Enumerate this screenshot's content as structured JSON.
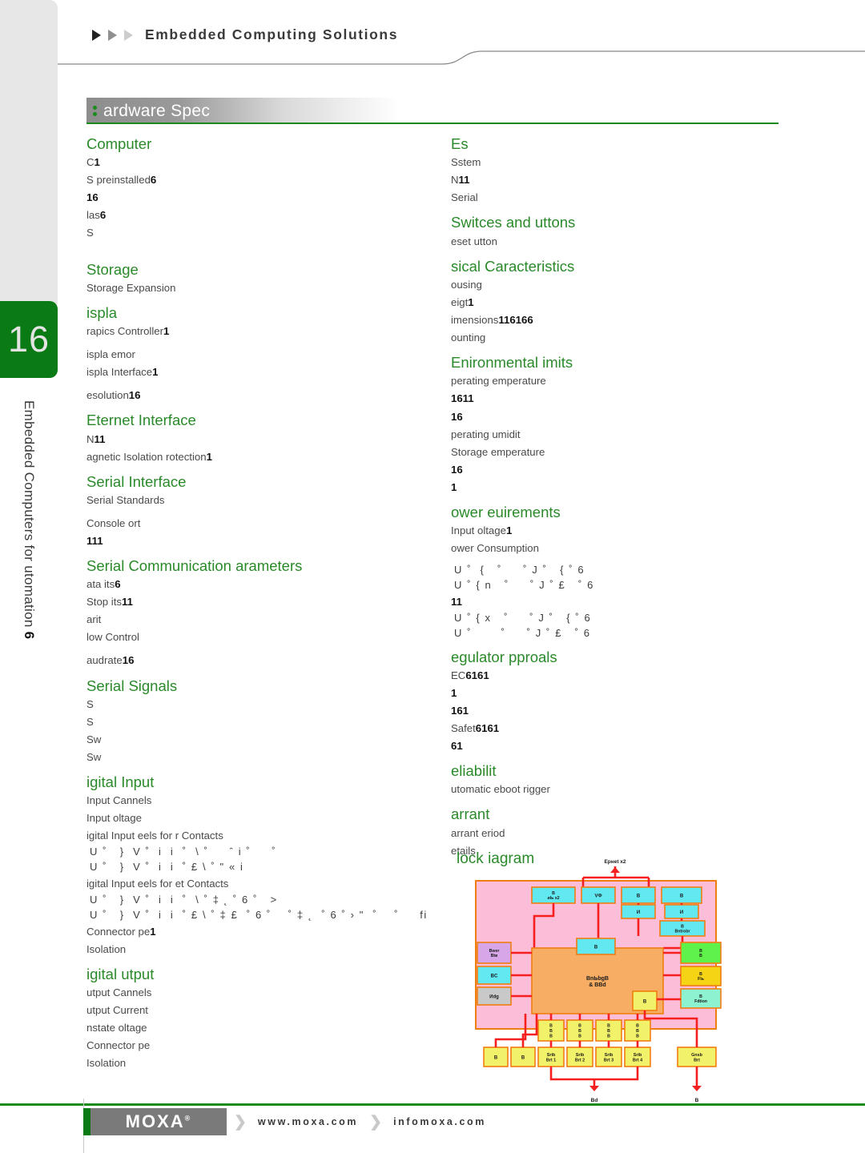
{
  "header": {
    "title": "Embedded Computing Solutions",
    "arrows": [
      "arrow-1",
      "arrow-2",
      "arrow-3"
    ]
  },
  "sidebar": {
    "page_number": "16",
    "vertical_label": "Embedded Computers for utomation",
    "vertical_number": "6"
  },
  "banner": {
    "title": "ardware Spec"
  },
  "left_column": [
    {
      "type": "heading",
      "text": "Computer"
    },
    {
      "type": "row",
      "text": "C",
      "value": "1"
    },
    {
      "type": "row",
      "text": "S preinstalled",
      "value": "6"
    },
    {
      "type": "row",
      "text": "",
      "value": "16"
    },
    {
      "type": "row",
      "text": "las",
      "value": "6"
    },
    {
      "type": "row",
      "text": "S",
      "value": ""
    },
    {
      "type": "gap"
    },
    {
      "type": "heading",
      "text": "Storage"
    },
    {
      "type": "row",
      "text": "Storage Expansion",
      "value": ""
    },
    {
      "type": "heading",
      "text": "ispla"
    },
    {
      "type": "row",
      "text": "rapics Controller",
      "value": "1"
    },
    {
      "type": "gap-s"
    },
    {
      "type": "row",
      "text": "ispla emor",
      "value": ""
    },
    {
      "type": "row",
      "text": "ispla Interface",
      "value": "1"
    },
    {
      "type": "gap-s"
    },
    {
      "type": "row",
      "text": "esolution",
      "value": "16"
    },
    {
      "type": "heading",
      "text": "Eternet Interface"
    },
    {
      "type": "row",
      "text": "N",
      "value": "11"
    },
    {
      "type": "row",
      "text": "agnetic Isolation rotection",
      "value": "1"
    },
    {
      "type": "heading",
      "text": "Serial Interface"
    },
    {
      "type": "row",
      "text": "Serial Standards",
      "value": ""
    },
    {
      "type": "gap-s"
    },
    {
      "type": "row",
      "text": "Console ort",
      "value": ""
    },
    {
      "type": "row",
      "text": "",
      "value": "111"
    },
    {
      "type": "heading",
      "text": "Serial Communication arameters"
    },
    {
      "type": "row",
      "text": "ata its",
      "value": "6"
    },
    {
      "type": "row",
      "text": "Stop its",
      "value": "11"
    },
    {
      "type": "row",
      "text": "arit",
      "value": ""
    },
    {
      "type": "row",
      "text": "low Control",
      "value": ""
    },
    {
      "type": "gap-s"
    },
    {
      "type": "row",
      "text": "audrate",
      "value": "16"
    },
    {
      "type": "heading",
      "text": "Serial Signals"
    },
    {
      "type": "row",
      "text": "S",
      "value": ""
    },
    {
      "type": "row",
      "text": "S",
      "value": ""
    },
    {
      "type": "row",
      "text": "Sw",
      "value": ""
    },
    {
      "type": "row",
      "text": "Sw",
      "value": ""
    },
    {
      "type": "heading",
      "text": "igital Input"
    },
    {
      "type": "row",
      "text": "Input Cannels",
      "value": ""
    },
    {
      "type": "row",
      "text": "Input oltage",
      "value": ""
    },
    {
      "type": "row",
      "text": "igital Input eels for r Contacts",
      "value": ""
    },
    {
      "type": "sym",
      "text": "U ˚   }  V ˚  i  i  ˚  \\ ˚     ˆ i ˚     ˚"
    },
    {
      "type": "sym",
      "text": "U ˚   }  V ˚  i  i  ˚ £ \\ ˚ \" « i"
    },
    {
      "type": "row",
      "text": "igital Input eels for et Contacts",
      "value": ""
    },
    {
      "type": "sym",
      "text": "U ˚   }  V ˚  i  i  ˚  \\ ˚ ‡ ˛ ˚ 6 ˚   >"
    },
    {
      "type": "sym",
      "text": "U ˚   }  V ˚  i  i  ˚ £ \\ ˚ ‡ £  ˚ 6 ˚    ˚ ‡ ˛  ˚ 6 ˚ › \"  ˚    ˚     fi"
    },
    {
      "type": "row",
      "text": "Connector pe",
      "value": "1"
    },
    {
      "type": "row",
      "text": "Isolation",
      "value": ""
    },
    {
      "type": "heading",
      "text": "igital utput"
    },
    {
      "type": "row",
      "text": "utput Cannels",
      "value": ""
    },
    {
      "type": "row",
      "text": "utput Current",
      "value": ""
    },
    {
      "type": "row",
      "text": "nstate oltage",
      "value": ""
    },
    {
      "type": "row",
      "text": "Connector pe",
      "value": ""
    },
    {
      "type": "row",
      "text": "Isolation",
      "value": ""
    }
  ],
  "right_column": [
    {
      "type": "heading",
      "text": "Es"
    },
    {
      "type": "row",
      "text": "Sstem",
      "value": ""
    },
    {
      "type": "row",
      "text": "N",
      "value": "11"
    },
    {
      "type": "row",
      "text": "Serial",
      "value": ""
    },
    {
      "type": "heading",
      "text": "Switces and uttons"
    },
    {
      "type": "row",
      "text": "eset utton",
      "value": ""
    },
    {
      "type": "heading",
      "text": "sical Caracteristics"
    },
    {
      "type": "row",
      "text": "ousing",
      "value": ""
    },
    {
      "type": "row",
      "text": "eigt",
      "value": "1"
    },
    {
      "type": "row",
      "text": "imensions",
      "value": "116166"
    },
    {
      "type": "row",
      "text": "ounting",
      "value": ""
    },
    {
      "type": "heading",
      "text": "Enironmental imits"
    },
    {
      "type": "row",
      "text": "perating emperature",
      "value": ""
    },
    {
      "type": "row",
      "text": "",
      "value": "1611"
    },
    {
      "type": "row",
      "text": "",
      "value": "16"
    },
    {
      "type": "row",
      "text": "perating umidit",
      "value": ""
    },
    {
      "type": "row",
      "text": "Storage emperature",
      "value": ""
    },
    {
      "type": "row",
      "text": "",
      "value": "16"
    },
    {
      "type": "row",
      "text": "",
      "value": "1"
    },
    {
      "type": "heading",
      "text": "ower euirements"
    },
    {
      "type": "row",
      "text": "Input oltage",
      "value": "1"
    },
    {
      "type": "row",
      "text": "ower Consumption",
      "value": ""
    },
    {
      "type": "gap-s"
    },
    {
      "type": "sym",
      "text": "U ˚  {   ˚     ˚ J ˚   { ˚ 6"
    },
    {
      "type": "sym",
      "text": "U ˚ { n   ˚     ˚ J ˚ £   ˚ 6"
    },
    {
      "type": "row",
      "text": "",
      "value": "11"
    },
    {
      "type": "sym",
      "text": "U ˚ { x   ˚     ˚ J ˚   { ˚ 6"
    },
    {
      "type": "sym",
      "text": "U ˚       ˚     ˚ J ˚ £   ˚ 6"
    },
    {
      "type": "heading",
      "text": "egulator pproals"
    },
    {
      "type": "row",
      "text": "EC",
      "value": "6161"
    },
    {
      "type": "row",
      "text": "",
      "value": "1"
    },
    {
      "type": "row",
      "text": "",
      "value": "161"
    },
    {
      "type": "row",
      "text": "Safet",
      "value": "6161"
    },
    {
      "type": "row",
      "text": "",
      "value": "61"
    },
    {
      "type": "heading",
      "text": "eliabilit"
    },
    {
      "type": "row",
      "text": "utomatic eboot rigger",
      "value": ""
    },
    {
      "type": "heading",
      "text": "arrant"
    },
    {
      "type": "row",
      "text": "arrant eriod",
      "value": ""
    },
    {
      "type": "row",
      "text": "etails",
      "value": ""
    }
  ],
  "block_diagram": {
    "title": "lock iagram",
    "top_label": "Ернet x2",
    "bottom_label_1": "Вd",
    "bottom_label_2": "В",
    "nodes": {
      "usb": "В\nиlь x2",
      "vga": "VФ",
      "lan1": "В",
      "lan2": "В",
      "phy1": "И",
      "phy2": "И",
      "controller": "В\nВntrobr",
      "ram": "В",
      "cpu": "ВnЬbgВ\n& ВВd",
      "power": "Вwer\nВtв",
      "rtc": "ВC",
      "wdg": "Иdg",
      "sram": "В\nВ",
      "flash": "В\nFlь",
      "expansion": "В\nFdtion",
      "small": "В",
      "uart1": "В\nВ\nВ",
      "uart2": "В\nВ\nВ",
      "uart3": "В\nВ\nВ",
      "uart4": "В\nВ\nВ",
      "di": "В",
      "do": "В",
      "serial1": "Srib\nВrt 1",
      "serial2": "Srib\nВrt 2",
      "serial3": "Srib\nВrt 3",
      "serial4": "Srib\nВrt 4",
      "console": "Gnsb\nВrt"
    },
    "colors": {
      "board": "#fcbdd8",
      "border": "#f07d10",
      "cpu": "#f7ad63",
      "cyan": "#62e8f0",
      "yellow": "#f2f26a",
      "green": "#5ef24a",
      "gold": "#f5d416",
      "mint": "#8df2cf",
      "purple": "#d7a6e8",
      "gray": "#c9c9c9",
      "wire": "#f51f1f"
    }
  },
  "footer": {
    "logo": "MOXA",
    "registered": "®",
    "link1": "www.moxa.com",
    "link2": "infomoxa.com"
  },
  "theme": {
    "green": "#2a8a2a",
    "badge_green": "#0a7a14",
    "rule_green": "#1a8a1a",
    "text_gray": "#4a4a4a"
  }
}
